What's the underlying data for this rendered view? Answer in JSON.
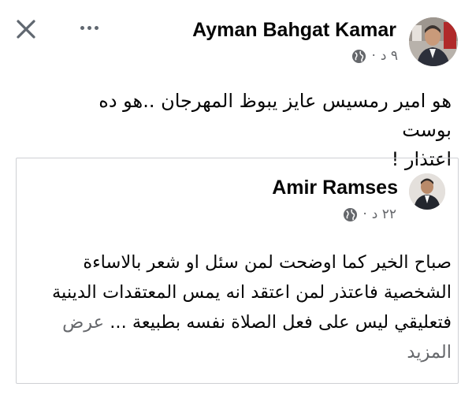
{
  "header": {
    "close_icon": "close-icon",
    "more_icon": "more-horizontal-icon"
  },
  "post": {
    "author": "Ayman Bahgat Kamar",
    "time": "٩ د",
    "separator": "·",
    "privacy_icon": "globe-icon",
    "text_line1": "هو امير رمسيس عايز يبوظ المهرجان ..هو ده بوست",
    "text_line2": "اعتذار !"
  },
  "quoted_post": {
    "author": "Amir Ramses",
    "time": "٢٢ د",
    "separator": "·",
    "privacy_icon": "globe-icon",
    "text_line1": "صباح الخير كما اوضحت لمن سئل او شعر بالاساءة",
    "text_line2": "الشخصية فاعتذر لمن اعتقد انه يمس المعتقدات الدينية",
    "text_line3": "فتعليقي ليس على فعل الصلاة نفسه بطبيعة ...",
    "see_more": "عرض المزيد"
  },
  "colors": {
    "text": "#050505",
    "secondary": "#65676b",
    "border": "#ced0d4"
  }
}
